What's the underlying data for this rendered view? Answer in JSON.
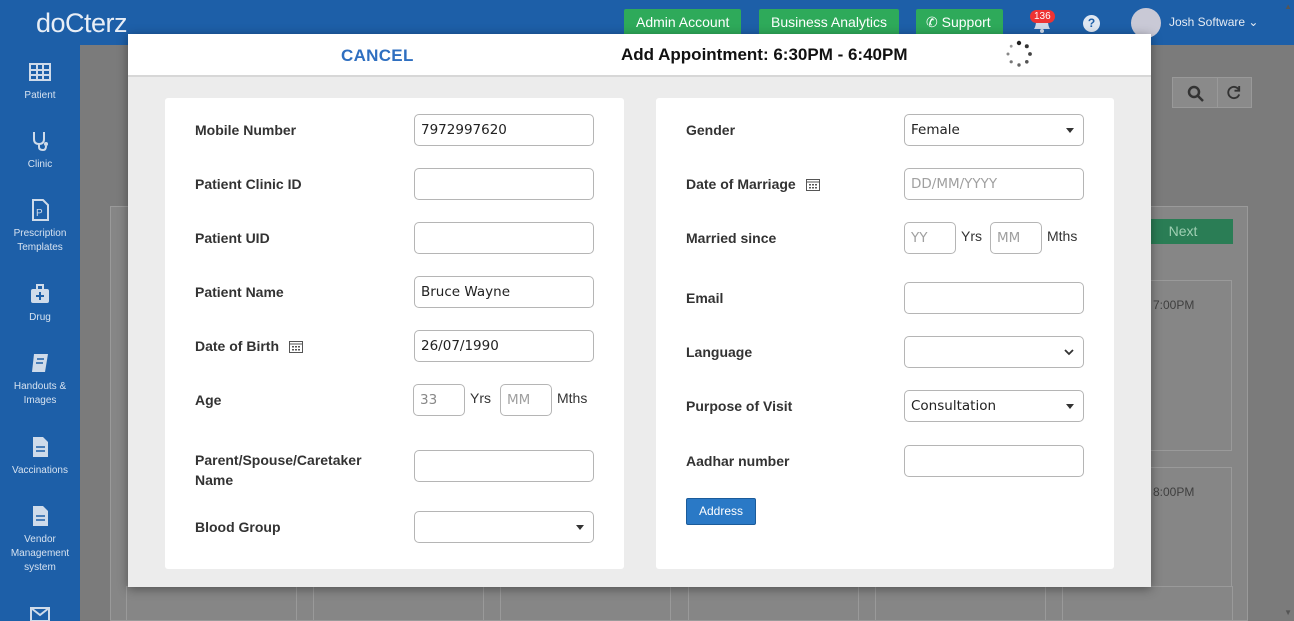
{
  "app": {
    "logo": "doCterz",
    "nav_buttons": [
      "Admin Account",
      "Business Analytics",
      "Support"
    ],
    "notification_count": "136",
    "help_label": "?",
    "user_name": "Josh Software"
  },
  "sidebar": {
    "items": [
      {
        "label": "Patient",
        "icon": "table-icon"
      },
      {
        "label": "Clinic",
        "icon": "stethoscope-icon"
      },
      {
        "label": "Prescription Templates",
        "icon": "prescription-icon"
      },
      {
        "label": "Drug",
        "icon": "medkit-icon"
      },
      {
        "label": "Handouts & Images",
        "icon": "book-icon"
      },
      {
        "label": "Vaccinations",
        "icon": "document-icon"
      },
      {
        "label": "Vendor Management system",
        "icon": "document-icon"
      }
    ]
  },
  "background": {
    "next_label": "Next",
    "time_slots": [
      "7:00PM",
      "8:00PM"
    ]
  },
  "modal": {
    "cancel_label": "CANCEL",
    "title": "Add Appointment: 6:30PM - 6:40PM",
    "left": {
      "mobile_label": "Mobile Number",
      "mobile_value": "7972997620",
      "clinic_id_label": "Patient Clinic ID",
      "clinic_id_value": "",
      "uid_label": "Patient UID",
      "uid_value": "",
      "name_label": "Patient Name",
      "name_value": "Bruce Wayne",
      "dob_label": "Date of Birth",
      "dob_value": "26/07/1990",
      "age_label": "Age",
      "age_years_value": "33",
      "age_years_unit": "Yrs",
      "age_months_placeholder": "MM",
      "age_months_unit": "Mths",
      "caretaker_label_line1": "Parent/Spouse/Caretaker",
      "caretaker_label_line2": "Name",
      "caretaker_value": "",
      "blood_group_label": "Blood Group",
      "blood_group_value": ""
    },
    "right": {
      "gender_label": "Gender",
      "gender_value": "Female",
      "dom_label": "Date of Marriage",
      "dom_placeholder": "DD/MM/YYYY",
      "married_since_label": "Married since",
      "married_years_placeholder": "YY",
      "married_years_unit": "Yrs",
      "married_months_placeholder": "MM",
      "married_months_unit": "Mths",
      "email_label": "Email",
      "email_value": "",
      "language_label": "Language",
      "language_value": "",
      "purpose_label": "Purpose of Visit",
      "purpose_value": "Consultation",
      "aadhar_label": "Aadhar number",
      "aadhar_value": "",
      "address_label": "Address"
    }
  },
  "colors": {
    "brand_blue": "#1d5fa8",
    "green_button": "#2eaa5a",
    "cancel_link": "#2f6fc0",
    "address_button": "#2a79c6"
  }
}
